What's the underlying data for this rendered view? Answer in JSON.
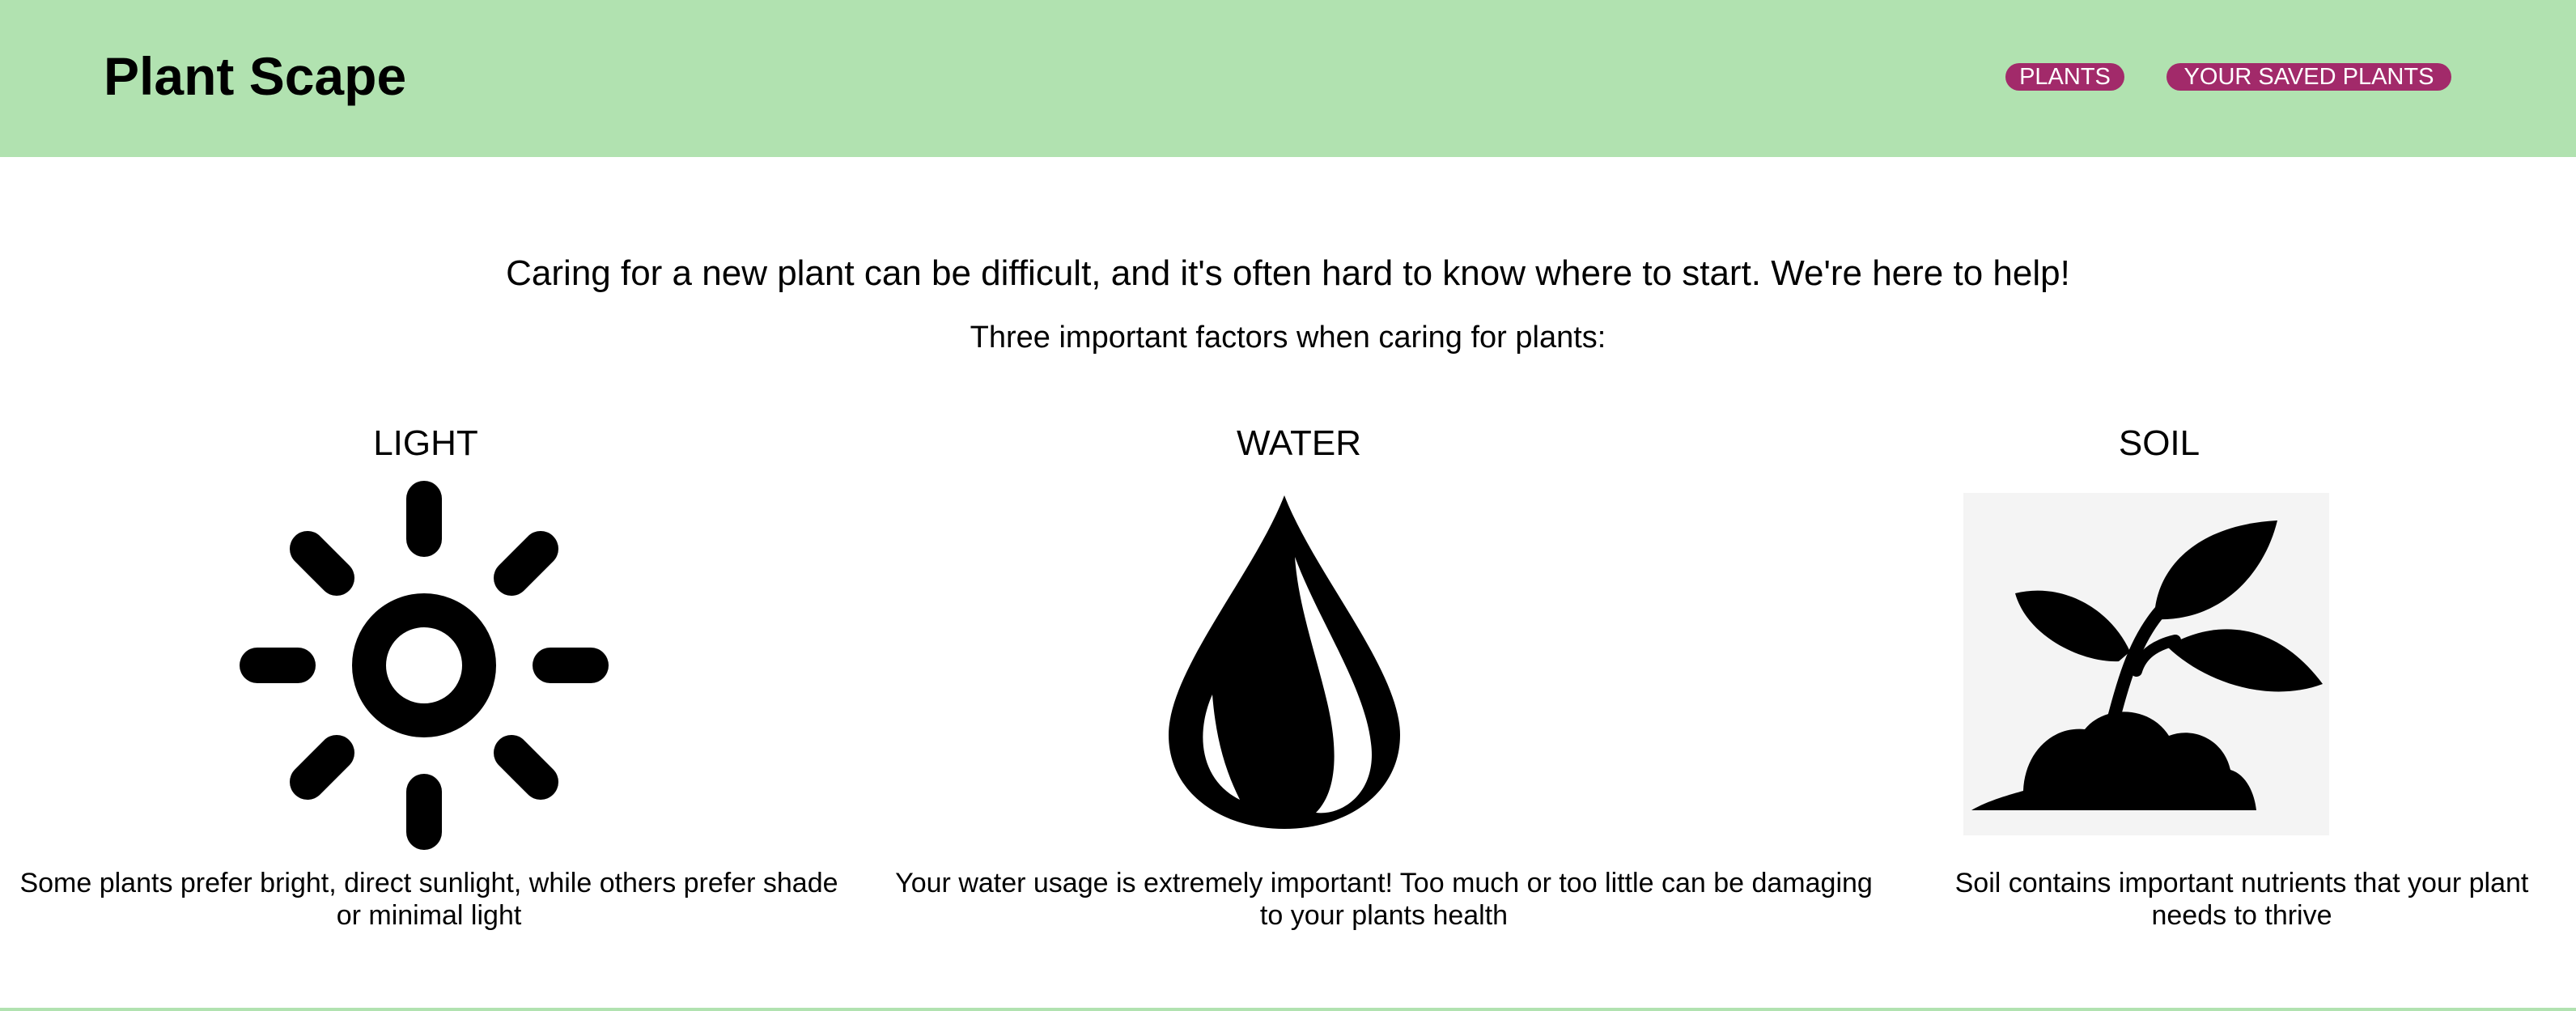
{
  "header": {
    "brand": "Plant Scape",
    "background_color": "#b1e2b0",
    "nav": {
      "plants_label": "PLANTS",
      "saved_label": "YOUR SAVED PLANTS",
      "button_color": "#a22a6a"
    }
  },
  "intro": {
    "headline": "Caring for a new plant can be difficult, and it's often hard to know where to start. We're here to help!",
    "subheadline": "Three important factors when caring for plants:"
  },
  "factors": [
    {
      "title": "LIGHT",
      "icon": "sun-icon",
      "description": "Some plants prefer bright, direct sunlight, while others prefer shade or minimal light"
    },
    {
      "title": "WATER",
      "icon": "water-drop-icon",
      "description": "Your water usage is extremely important! Too much or too little can be damaging to your plants health"
    },
    {
      "title": "SOIL",
      "icon": "sprout-soil-icon",
      "description": "Soil contains important nutrients that your plant needs to thrive"
    }
  ]
}
